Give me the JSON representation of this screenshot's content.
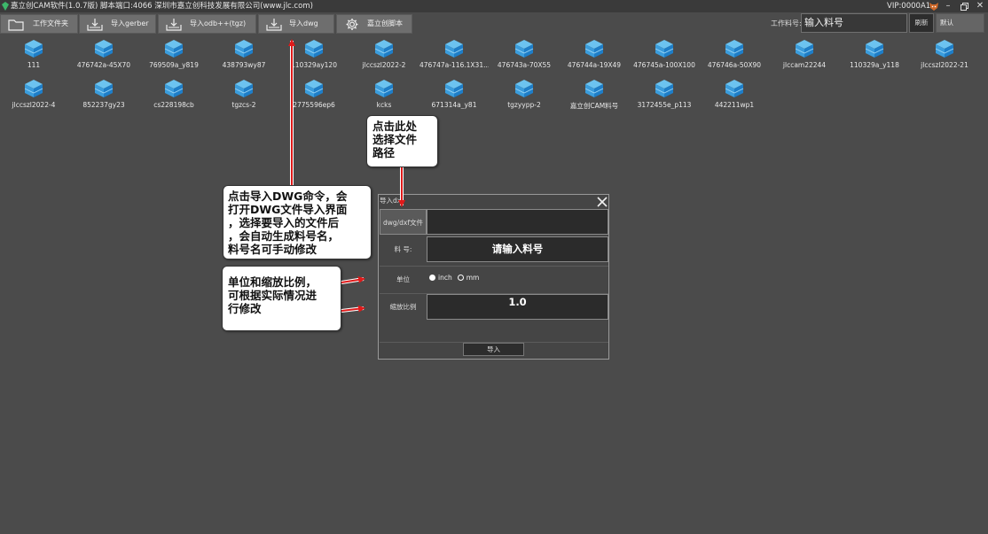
{
  "titlebar": {
    "title": "嘉立创CAM软件(1.0.7版) 脚本端口:4066 深圳市嘉立创科技发展有限公司(www.jlc.com)",
    "vip": "VIP:0000A1"
  },
  "toolbar": {
    "buttons": [
      {
        "label": "工作文件夹",
        "icon": "folder-icon"
      },
      {
        "label": "导入gerber",
        "icon": "import-tray-icon"
      },
      {
        "label": "导入odb++(tgz)",
        "icon": "import-tray-icon"
      },
      {
        "label": "导入dwg",
        "icon": "import-tray-icon"
      },
      {
        "label": "嘉立创脚本",
        "icon": "gear-icon"
      }
    ],
    "lookup_label": "工作料号:",
    "lookup_value": "输入料号",
    "refresh_label": "刷新",
    "default_label": "默认"
  },
  "files": [
    "111",
    "476742a-45X70",
    "769509a_y819",
    "438793wy87",
    "110329ay120",
    "jlccszl2022-2",
    "476747a-116.1X31...",
    "476743a-70X55",
    "476744a-19X49",
    "476745a-100X100",
    "476746a-50X90",
    "jlccam22244",
    "110329a_y118",
    "jlccszl2022-21",
    "jlccszl2022-4",
    "852237gy23",
    "cs228198cb",
    "tgzcs-2",
    "2775596ep6",
    "kcks",
    "671314a_y81",
    "tgzyypp-2",
    "嘉立创CAM料号",
    "3172455e_p113",
    "442211wp1"
  ],
  "dialog": {
    "title": "导入dx",
    "file_label": "dwg/dxf文件",
    "file_value": "",
    "part_label": "料 号:",
    "part_value": "请输入料号",
    "unit_label": "单位",
    "unit_inch": "inch",
    "unit_mm": "mm",
    "scale_label": "缩放比例",
    "scale_value": "1.0",
    "import_label": "导入"
  },
  "callouts": {
    "path": "点击此处\n选择文件\n路径",
    "dwg": "点击导入DWG命令，会\n打开DWG文件导入界面\n，选择要导入的文件后\n，会自动生成料号名，\n料号名可手动修改",
    "unit": "单位和缩放比例，\n可根据实际情况进\n行修改"
  },
  "colors": {
    "background": "#4b4b4b",
    "toolbar_button": "#6e6e6e",
    "cube_top": "#6cc3f0",
    "cube_side": "#1e7ec8",
    "arrow": "#e01a1a"
  }
}
